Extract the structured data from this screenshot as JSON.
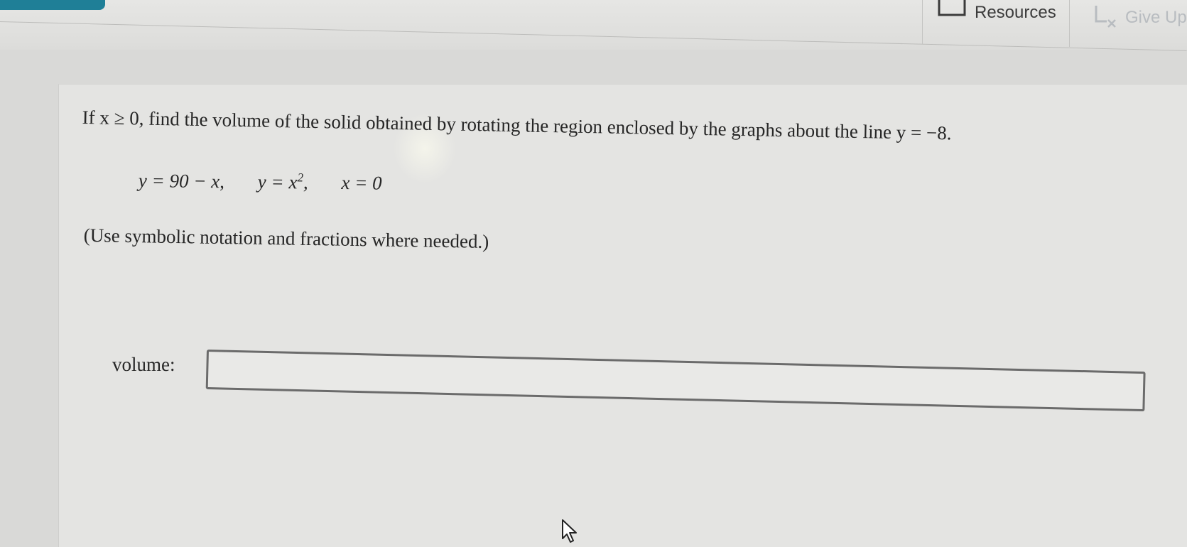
{
  "toolbar": {
    "resources_label": "Resources",
    "giveup_label": "Give Up"
  },
  "question": {
    "intro": "If x ≥ 0, find the volume of the solid obtained by rotating the region enclosed by the graphs about the line y = −8.",
    "equation1": "y = 90 − x,",
    "equation2_base": "y = x",
    "equation2_exp": "2",
    "equation2_tail": ",",
    "equation3": "x = 0",
    "hint": "(Use symbolic notation and fractions where needed.)"
  },
  "answer": {
    "label": "volume:",
    "value": ""
  },
  "colors": {
    "teal_tab": "#1f7f97",
    "text": "#262626",
    "input_border": "#6b6b6b"
  },
  "icons": {
    "resources": "resources-icon",
    "giveup": "give-up-icon",
    "cursor": "mouse-cursor-icon"
  }
}
